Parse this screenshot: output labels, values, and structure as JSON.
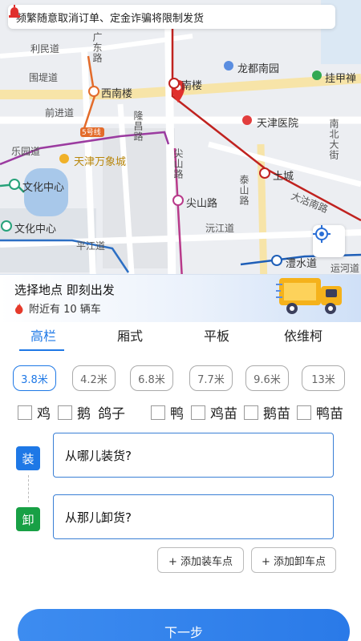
{
  "notice": {
    "text": "频繁随意取消订单、定金诈骗将限制发货",
    "icon": "alarm-icon"
  },
  "map": {
    "labels": {
      "liminDao": "利民道",
      "guangdongLu": "广东路",
      "weidiDao": "围堤道",
      "xinanlou": "西南楼",
      "nanlou": "南楼",
      "longdu": "龙都南园",
      "guajiachan": "挂甲禅",
      "qianjinDao": "前进道",
      "longchangLu": "隆昌路",
      "line5": "5号线",
      "tianjinHospital": "天津医院",
      "nanbeiDajie": "南北大街",
      "leyuanDao": "乐园道",
      "wanxiangcheng": "天津万象城",
      "jianshanLu": "尖山路",
      "tucheng": "土城",
      "taishanLu": "泰山路",
      "dagunanLu": "大沽南路",
      "wenhua1": "文化中心",
      "wenhua2": "文化中心",
      "jianshanStation": "尖山路",
      "yuanjiangDao": "沅江道",
      "pingjiangDao": "平江道",
      "lishuiDao": "澧水道",
      "yunqiaoRoad": "运河道"
    }
  },
  "banner": {
    "title": "选择地点 即刻出发",
    "nearby": "附近有 10 辆车"
  },
  "tabs": [
    {
      "label": "高栏",
      "active": true
    },
    {
      "label": "厢式",
      "active": false
    },
    {
      "label": "平板",
      "active": false
    },
    {
      "label": "依维柯",
      "active": false
    }
  ],
  "lengths": [
    {
      "label": "3.8米",
      "selected": true
    },
    {
      "label": "4.2米",
      "selected": false
    },
    {
      "label": "6.8米",
      "selected": false
    },
    {
      "label": "7.7米",
      "selected": false
    },
    {
      "label": "9.6米",
      "selected": false
    },
    {
      "label": "13米",
      "selected": false
    }
  ],
  "cargo": [
    "鸡",
    "鹅",
    "鸽子",
    "鸭",
    "鸡苗",
    "鹅苗",
    "鸭苗"
  ],
  "address": {
    "load_badge": "装",
    "load_placeholder": "从哪儿装货?",
    "unload_badge": "卸",
    "unload_placeholder": "从那儿卸货?"
  },
  "buttons": {
    "add_load": "+ 添加装车点",
    "add_unload": "+ 添加卸车点",
    "next": "下一步"
  },
  "colors": {
    "accent": "#1e78e6",
    "unload_green": "#18a045",
    "metro_red": "#d81e1e"
  }
}
